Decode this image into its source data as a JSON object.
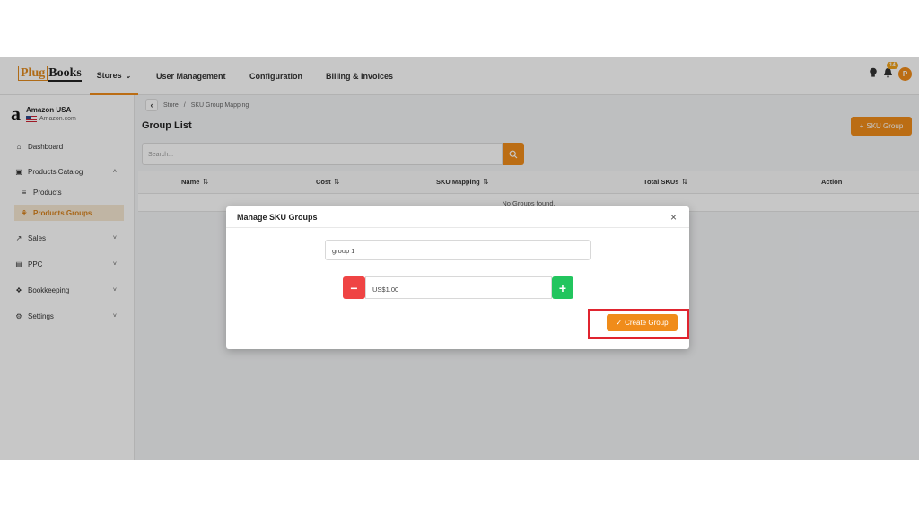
{
  "header": {
    "logo_part1": "Plug",
    "logo_part2": "Books",
    "nav": [
      {
        "label": "Stores"
      },
      {
        "label": "User Management"
      },
      {
        "label": "Configuration"
      },
      {
        "label": "Billing & Invoices"
      }
    ],
    "notification_count": "14",
    "avatar_initial": "P",
    "icons": [
      "bulb-icon",
      "bell-icon",
      "chevron-down-icon"
    ]
  },
  "sidebar": {
    "store_name": "Amazon USA",
    "store_domain": "Amazon.com",
    "store_logo": "a",
    "items": [
      {
        "label": "Dashboard",
        "icon": "home-icon"
      },
      {
        "label": "Products Catalog",
        "icon": "box-icon"
      },
      {
        "label": "Products",
        "icon": "list-icon"
      },
      {
        "label": "Products Groups",
        "icon": "group-icon"
      },
      {
        "label": "Sales",
        "icon": "chart-icon"
      },
      {
        "label": "PPC",
        "icon": "ppc-icon"
      },
      {
        "label": "Bookkeeping",
        "icon": "book-icon"
      },
      {
        "label": "Settings",
        "icon": "gear-icon"
      }
    ]
  },
  "main": {
    "breadcrumb": [
      "Store",
      "SKU Group Mapping"
    ],
    "breadcrumb_sep": "/",
    "title": "Group List",
    "add_button": "SKU Group",
    "search_placeholder": "Search...",
    "table": {
      "columns": [
        "Name",
        "Cost",
        "SKU Mapping",
        "Total SKUs",
        "Action"
      ],
      "empty_message": "No Groups found."
    }
  },
  "modal": {
    "title": "Manage SKU Groups",
    "group_name_value": "group 1",
    "cost_value": "US$1.00",
    "create_button": "Create Group"
  },
  "colors": {
    "accent": "#f08c1a",
    "danger": "#ef4444",
    "success": "#22c55e",
    "highlight": "#e0242f"
  }
}
